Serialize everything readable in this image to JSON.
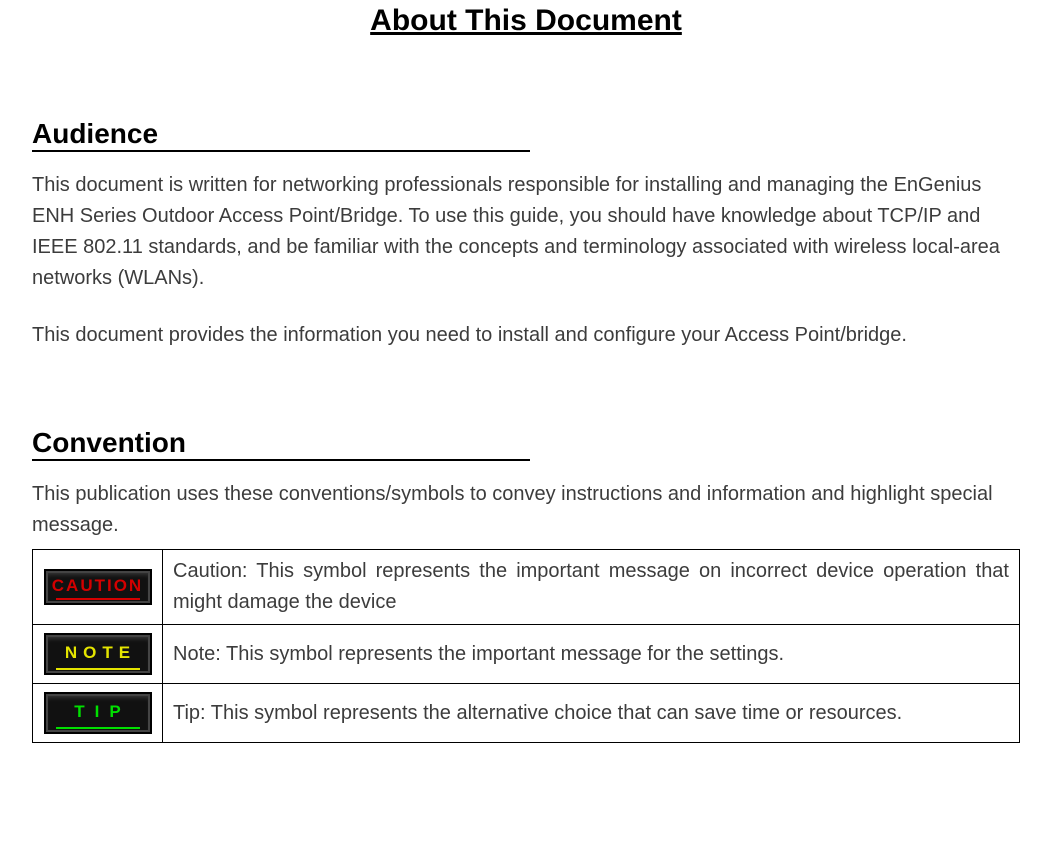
{
  "title": "About This Document",
  "sections": {
    "audience": {
      "heading": "Audience",
      "p1": "This document is written for networking professionals responsible for installing and managing the EnGenius ENH Series Outdoor Access Point/Bridge. To use this guide, you should have knowledge about TCP/IP and IEEE 802.11 standards, and be familiar with the concepts and terminology associated with wireless local-area networks (WLANs).",
      "p2": "This document provides the information you need to install and configure your Access Point/bridge."
    },
    "convention": {
      "heading": "Convention",
      "intro": "This publication uses these conventions/symbols to convey instructions and information and highlight special message.",
      "rows": [
        {
          "badge": "CAUTION",
          "badgeClass": "badge-caution",
          "desc": "Caution: This symbol represents the important message on incorrect device operation that might damage the device"
        },
        {
          "badge": "NOTE",
          "badgeClass": "badge-note",
          "desc": "Note: This symbol represents the important message for the settings."
        },
        {
          "badge": "TIP",
          "badgeClass": "badge-tip",
          "desc": "Tip: This symbol represents the alternative choice that can save time or resources."
        }
      ]
    }
  }
}
